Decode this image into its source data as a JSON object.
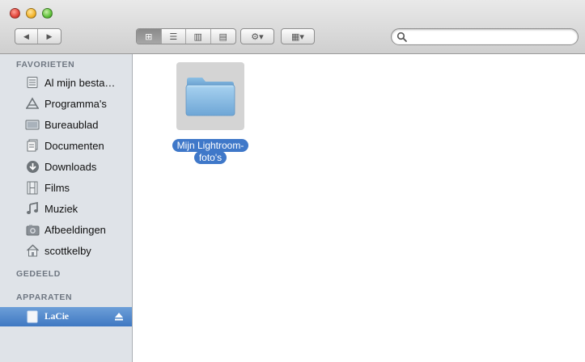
{
  "toolbar": {
    "nav_back": "◀",
    "nav_forward": "▶",
    "views": [
      "⊞",
      "☰",
      "▥",
      "▤"
    ],
    "action_label": "⚙▾",
    "arrange_label": "▦▾",
    "search_placeholder": ""
  },
  "sidebar": {
    "favorites_header": "FAVORIETEN",
    "favorites": [
      {
        "label": "Al mijn besta…",
        "icon": "all-files-icon"
      },
      {
        "label": "Programma's",
        "icon": "applications-icon"
      },
      {
        "label": "Bureaublad",
        "icon": "desktop-icon"
      },
      {
        "label": "Documenten",
        "icon": "documents-icon"
      },
      {
        "label": "Downloads",
        "icon": "downloads-icon"
      },
      {
        "label": "Films",
        "icon": "movies-icon"
      },
      {
        "label": "Muziek",
        "icon": "music-icon"
      },
      {
        "label": "Afbeeldingen",
        "icon": "pictures-icon"
      },
      {
        "label": "scottkelby",
        "icon": "home-icon"
      }
    ],
    "shared_header": "GEDEELD",
    "devices_header": "APPARATEN",
    "devices": [
      {
        "label": "LaCie",
        "icon": "drive-icon",
        "selected": true
      }
    ]
  },
  "content": {
    "items": [
      {
        "label_line1": "Mijn Lightroom-",
        "label_line2": "foto's",
        "icon": "folder-icon",
        "selected": true
      }
    ]
  },
  "colors": {
    "selection": "#3f78c9",
    "sidebar_bg": "#dfe3e8",
    "folder": "#8cc0e6"
  }
}
